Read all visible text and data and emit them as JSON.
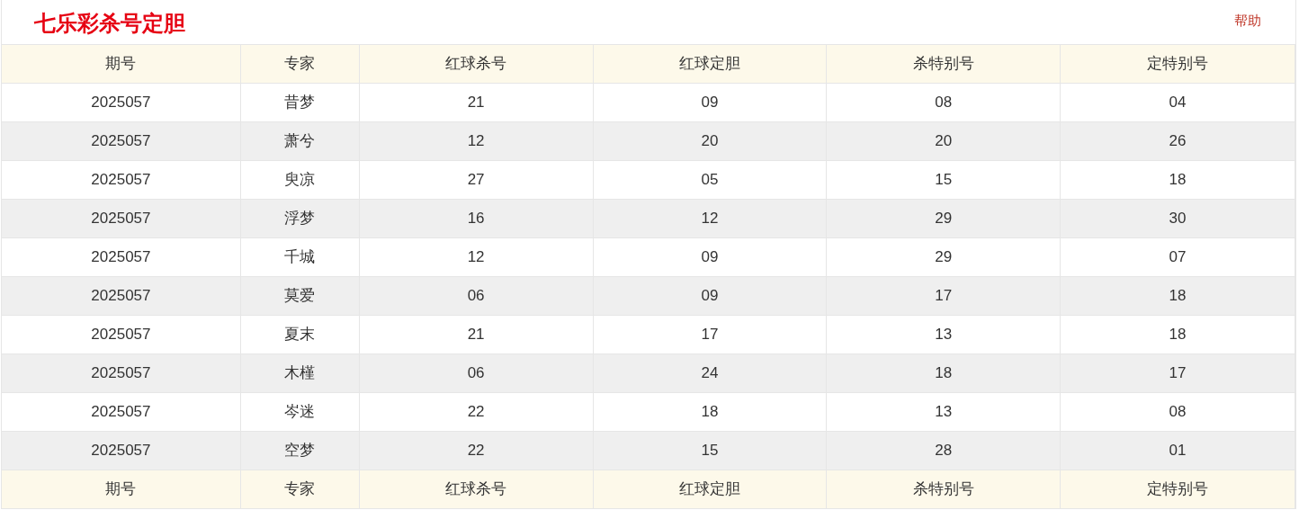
{
  "title": "七乐彩杀号定胆",
  "help_link": "帮助",
  "columns": [
    "期号",
    "专家",
    "红球杀号",
    "红球定胆",
    "杀特别号",
    "定特别号"
  ],
  "rows": [
    [
      "2025057",
      "昔梦",
      "21",
      "09",
      "08",
      "04"
    ],
    [
      "2025057",
      "萧兮",
      "12",
      "20",
      "20",
      "26"
    ],
    [
      "2025057",
      "臾凉",
      "27",
      "05",
      "15",
      "18"
    ],
    [
      "2025057",
      "浮梦",
      "16",
      "12",
      "29",
      "30"
    ],
    [
      "2025057",
      "千城",
      "12",
      "09",
      "29",
      "07"
    ],
    [
      "2025057",
      "莫爱",
      "06",
      "09",
      "17",
      "18"
    ],
    [
      "2025057",
      "夏末",
      "21",
      "17",
      "13",
      "18"
    ],
    [
      "2025057",
      "木槿",
      "06",
      "24",
      "18",
      "17"
    ],
    [
      "2025057",
      "岑迷",
      "22",
      "18",
      "13",
      "08"
    ],
    [
      "2025057",
      "空梦",
      "22",
      "15",
      "28",
      "01"
    ]
  ],
  "footer_columns": [
    "期号",
    "专家",
    "红球杀号",
    "红球定胆",
    "杀特别号",
    "定特别号"
  ]
}
